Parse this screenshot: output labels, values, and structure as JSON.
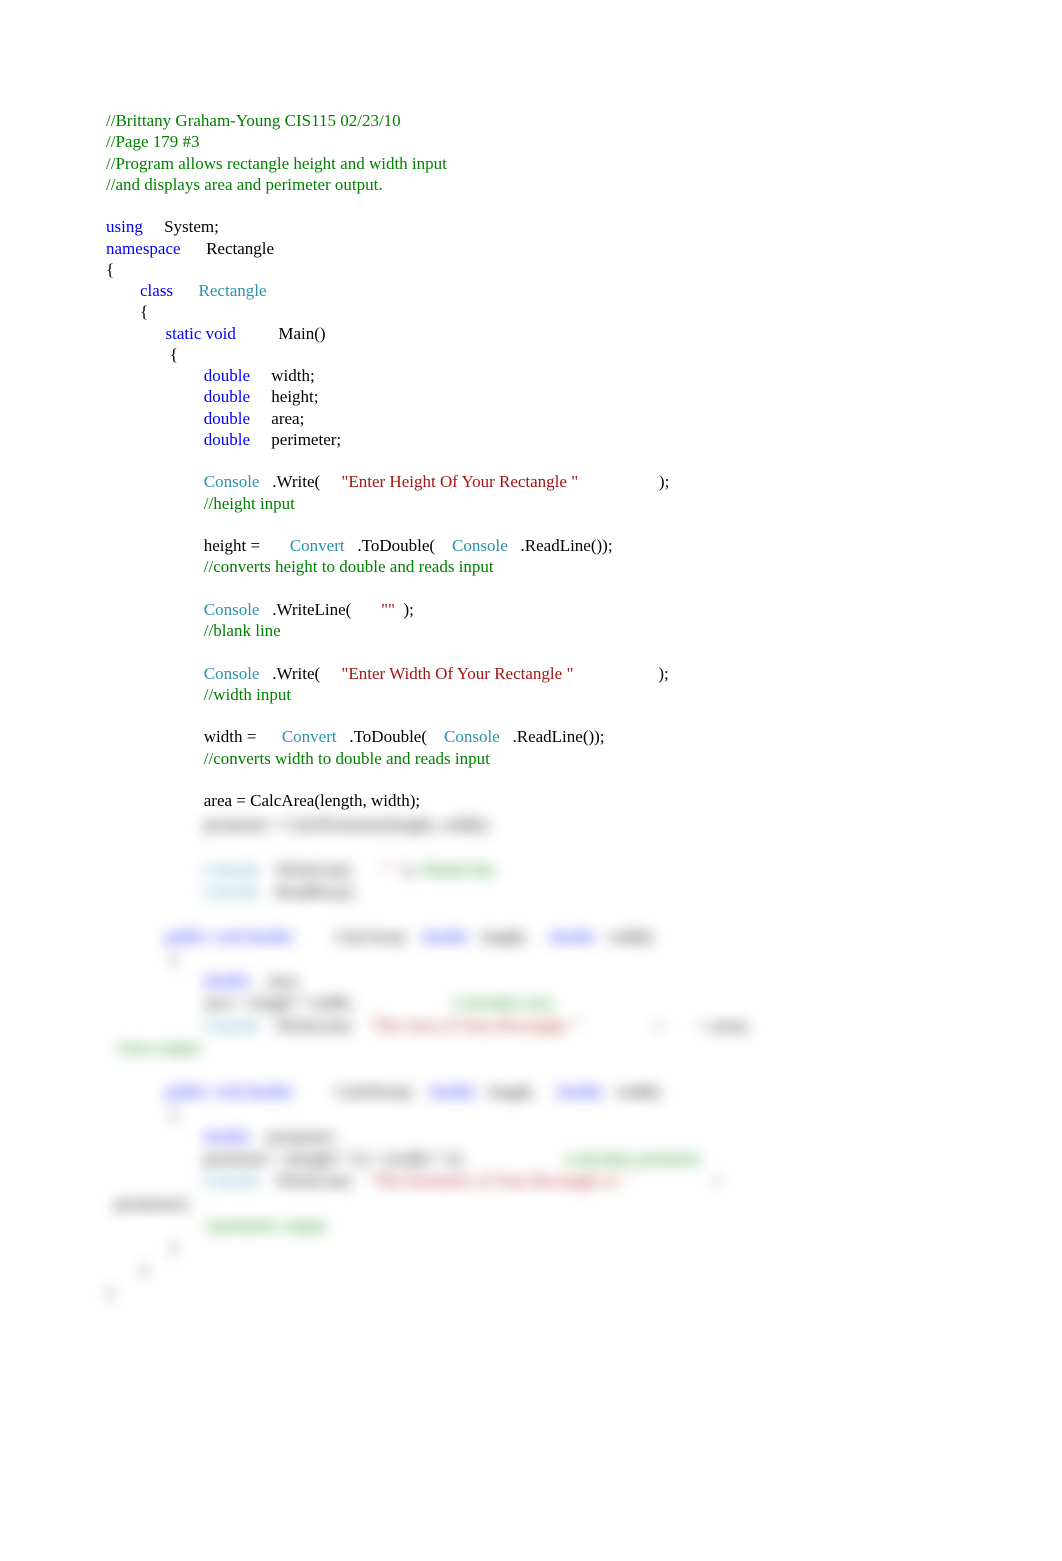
{
  "header": {
    "c1": "//Brittany Graham-Young CIS115 02/23/10",
    "c2": "//Page 179 #3",
    "c3": "//Program allows rectangle height and width input",
    "c4": "//and displays area and perimeter output."
  },
  "code": {
    "using": "using",
    "system": "     System;",
    "namespace": "namespace",
    "rectangle_ns": "      Rectangle",
    "open_brace1": "{",
    "indent1": "        ",
    "class_kw": "class",
    "class_name": "      Rectangle",
    "open_brace2": "        {",
    "indent2": "              ",
    "static_void": "static void",
    "main": "          Main()",
    "open_brace3": "               {",
    "indent3": "                       ",
    "double": "double",
    "width_decl": "     width;",
    "height_decl": "     height;",
    "area_decl": "     area;",
    "perim_decl": "     perimeter;",
    "console": "Console",
    "write": "   .Write(     ",
    "str_height": "\"Enter Height Of Your Rectangle \"",
    "close_write": "                   );",
    "c_height": "//height input",
    "height_eq": "height =       ",
    "convert": "Convert",
    "todouble": "   .ToDouble(    ",
    "readline": "   .ReadLine());",
    "c_conv_height": "//converts height to double and reads input",
    "writeline": "   .WriteLine(       ",
    "empty_str": "\"\"",
    "close_wl": "  );",
    "c_blank": "//blank line",
    "str_width": "\"Enter Width Of Your Rectangle \"",
    "close_write2": "                    );",
    "c_width_input": "//width input",
    "width_eq": "width =      ",
    "c_conv_width": "//converts width to double and reads input",
    "area_calc": "area = CalcArea(length, width);"
  },
  "blurred": {
    "l1_a": "                       perimeter = ",
    "l1_b": "CalcPerimeter(length, width);",
    "l2_a": "                       ",
    "l2_cns": "Console",
    "l2_b": "   .WriteLine(       ",
    "l2_c": "\"\"",
    "l2_d": "  );",
    "l2_e": " //blank line",
    "l3_a": "                       ",
    "l3_cns": "Console",
    "l3_b": "   .ReadKey();",
    "l4_a": "              ",
    "l4_b": "public void double",
    "l4_c": "          CalcArea(    ",
    "l4_d": "double",
    "l4_e": "   length,     ",
    "l4_f": "double",
    "l4_g": "   width)",
    "l5_a": "               {",
    "l6_a": "                       ",
    "l6_b": "double",
    "l6_c": "    area;",
    "l7_a": "                       area = length * width;",
    "l7_b": "                       //calculate area",
    "l8_a": "                       ",
    "l8_cns": "Console",
    "l8_b": "   .WriteLine(    ",
    "l8_c": "\"The Area of Your Rectangle: \"",
    "l8_d": "                 +       ",
    "l8_e": " + area);",
    "l9_a": "  //area output",
    "l10_a": "              ",
    "l10_b": "public void double",
    "l10_c": "          CalcPerim(    ",
    "l10_d": "double",
    "l10_e": "   length,     ",
    "l10_f": "double",
    "l10_g": "   width)",
    "l11_a": "               {",
    "l12_a": "                       ",
    "l12_b": "double",
    "l12_c": "    perimeter;",
    "l13_a": "                       perimeter = (height * 2) + (width * 2);",
    "l13_b": "                       //calculate perimeter",
    "l14_a": "                       ",
    "l14_cns": "Console",
    "l14_b": "   .WriteLine(    ",
    "l14_c": "\"The Perimeter of Your Rectangle is: \"",
    "l14_d": "                   + ",
    "l15_a": "  perimeter);",
    "l16_a": "                       ",
    "l16_b": "//perimeter output",
    "l17_a": "               }",
    "l18_a": "        }",
    "l19_a": "}"
  }
}
